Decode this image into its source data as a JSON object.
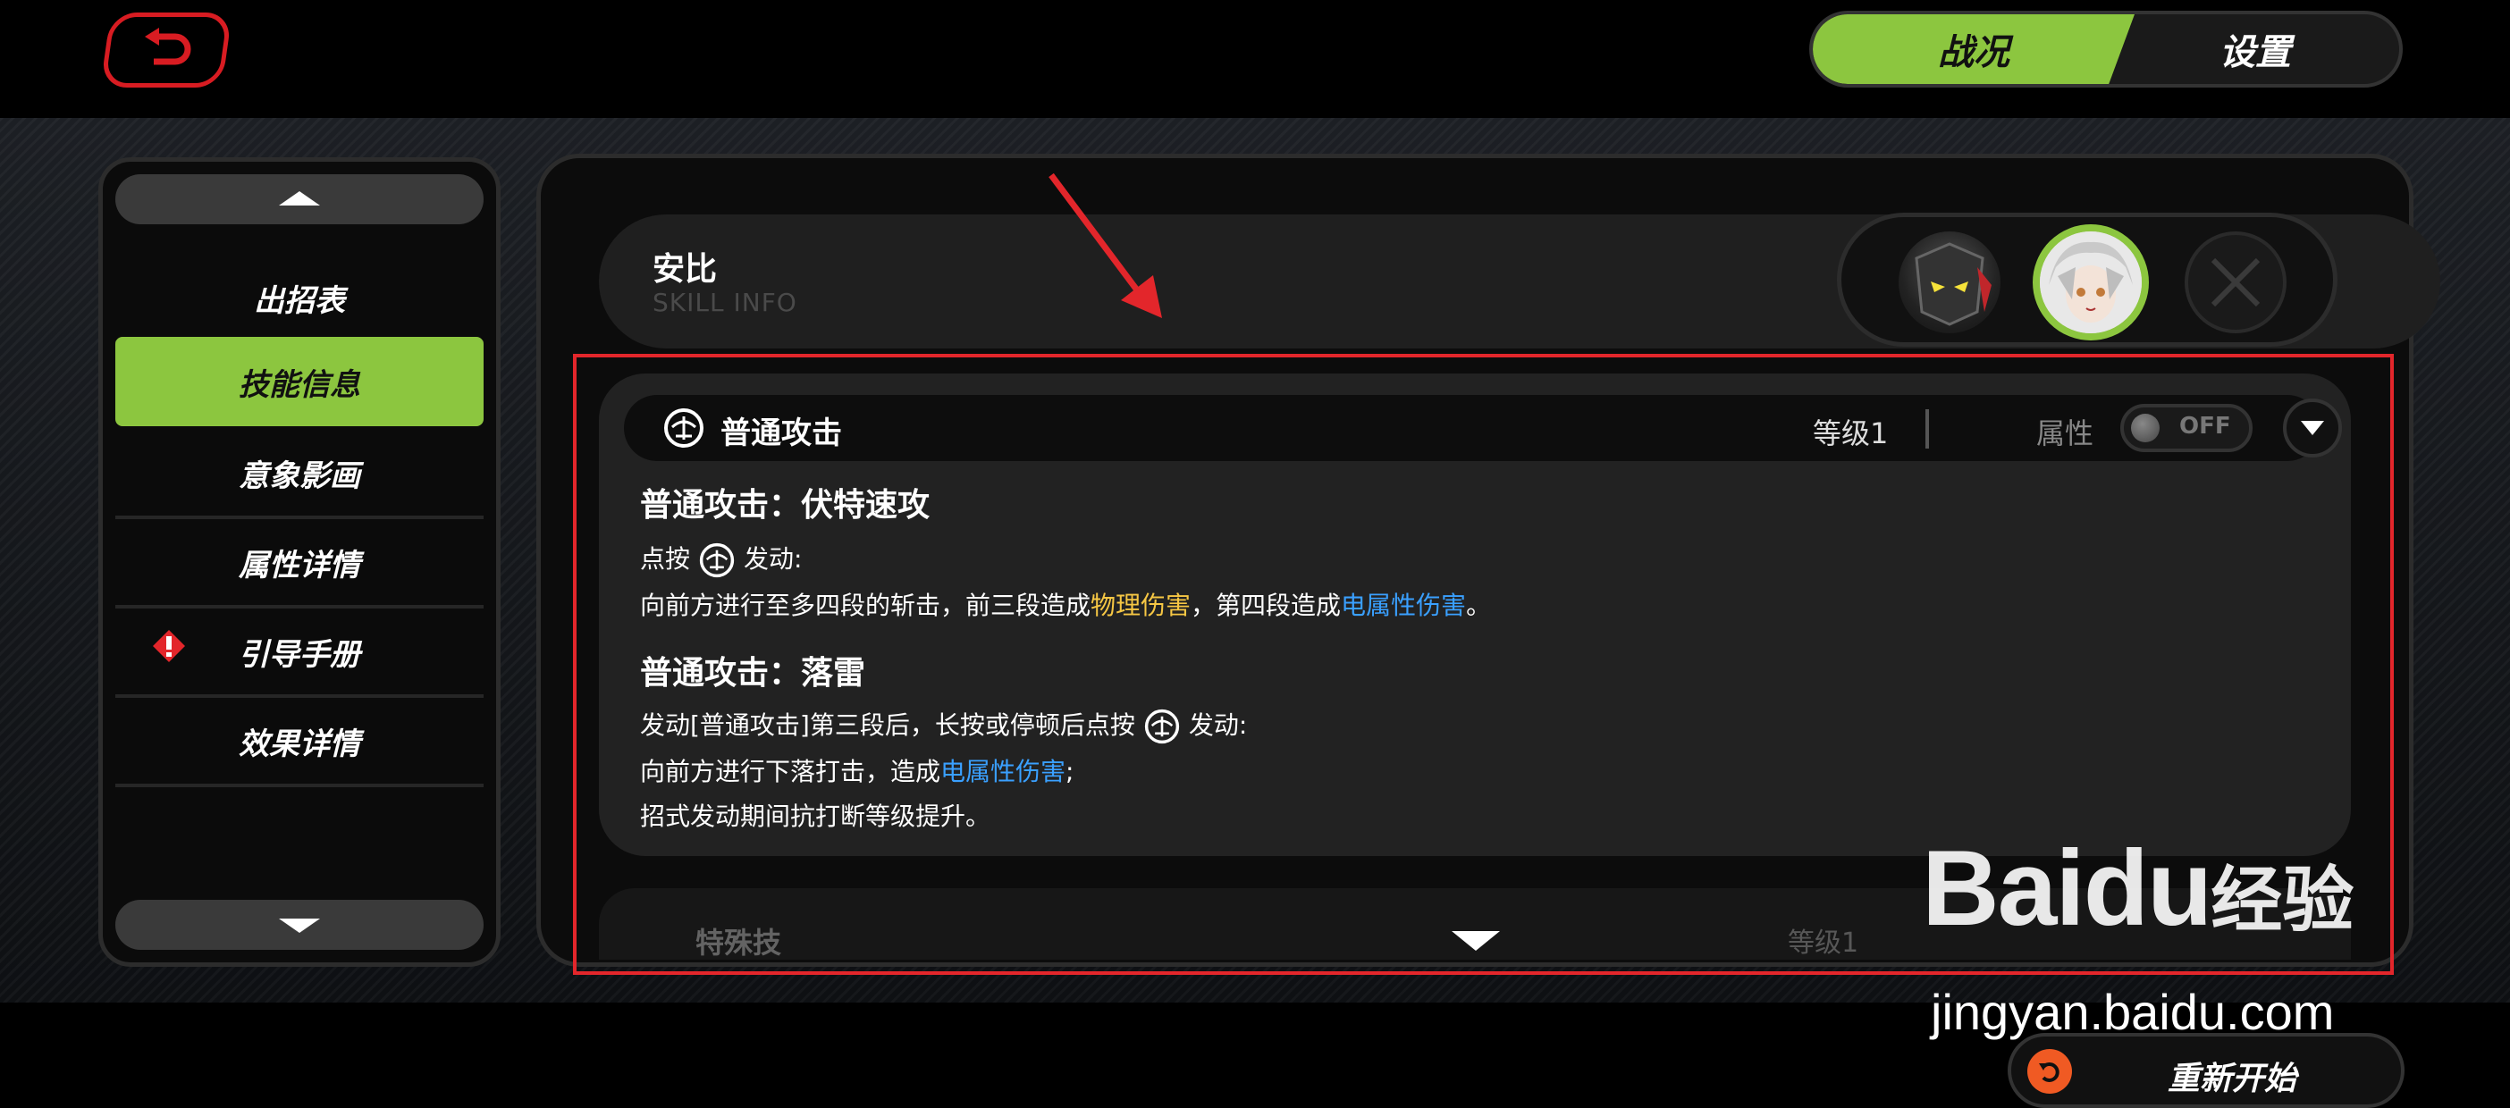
{
  "top_tabs": {
    "active": "战况",
    "inactive": "设置"
  },
  "sidebar": {
    "items": [
      {
        "label": "出招表"
      },
      {
        "label": "技能信息"
      },
      {
        "label": "意象影画"
      },
      {
        "label": "属性详情"
      },
      {
        "label": "引导手册"
      },
      {
        "label": "效果详情"
      }
    ]
  },
  "character": {
    "name": "安比",
    "subtitle": "SKILL INFO"
  },
  "skill": {
    "title": "普通攻击",
    "level": "等级1",
    "attr_label": "属性",
    "toggle": "OFF",
    "section1": {
      "title": "普通攻击：伏特速攻",
      "line1_a": "点按",
      "line1_b": "发动:",
      "line2_a": "向前方进行至多四段的斩击，前三段造成",
      "line2_physical": "物理伤害",
      "line2_b": "，第四段造成",
      "line2_electric": "电属性伤害",
      "line2_c": "。"
    },
    "section2": {
      "title": "普通攻击：落雷",
      "line1_a": "发动[普通攻击]第三段后，长按或停顿后点按",
      "line1_b": "发动:",
      "line2_a": "向前方进行下落打击，造成",
      "line2_electric": "电属性伤害",
      "line2_b": ";",
      "line3": "招式发动期间抗打断等级提升。"
    }
  },
  "skill2": {
    "title": "特殊技",
    "level": "等级1"
  },
  "bottom": {
    "restart": "重新开始"
  },
  "watermark": {
    "logo": "Bai",
    "logo_b": "du",
    "cn": "经验",
    "url": "jingyan.baidu.com"
  },
  "colors": {
    "accent": "#8cc63f",
    "physical": "#f6c744",
    "electric": "#3aa0ff",
    "highlight_box": "#e3262b"
  }
}
